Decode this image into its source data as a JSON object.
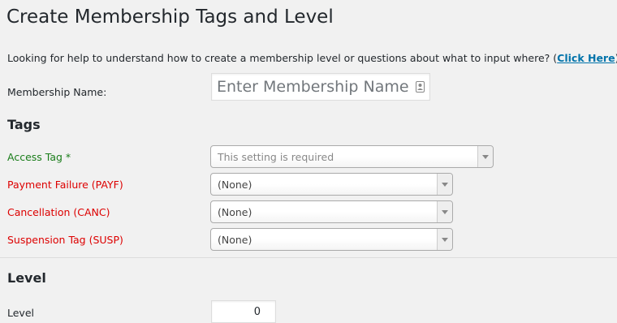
{
  "page": {
    "title": "Create Membership Tags and Level",
    "help_text": "Looking for help to understand how to create a membership level or questions about what to input where? (",
    "help_link": "Click Here",
    "help_close": ")"
  },
  "membership_name": {
    "label": "Membership Name:",
    "placeholder": "Enter Membership Name",
    "icon": "contact-card-icon"
  },
  "tags": {
    "heading": "Tags",
    "access_tag": {
      "label": "Access Tag",
      "required_mark": " *",
      "value": "This setting is required",
      "color": "#1a7d1a"
    },
    "payment_failure": {
      "label": "Payment Failure (PAYF)",
      "value": "(None)",
      "color": "#dd0000"
    },
    "cancellation": {
      "label": "Cancellation (CANC)",
      "value": "(None)",
      "color": "#dd0000"
    },
    "suspension": {
      "label": "Suspension Tag (SUSP)",
      "value": "(None)",
      "color": "#dd0000"
    }
  },
  "level": {
    "heading": "Level",
    "label": "Level",
    "value": "0"
  }
}
